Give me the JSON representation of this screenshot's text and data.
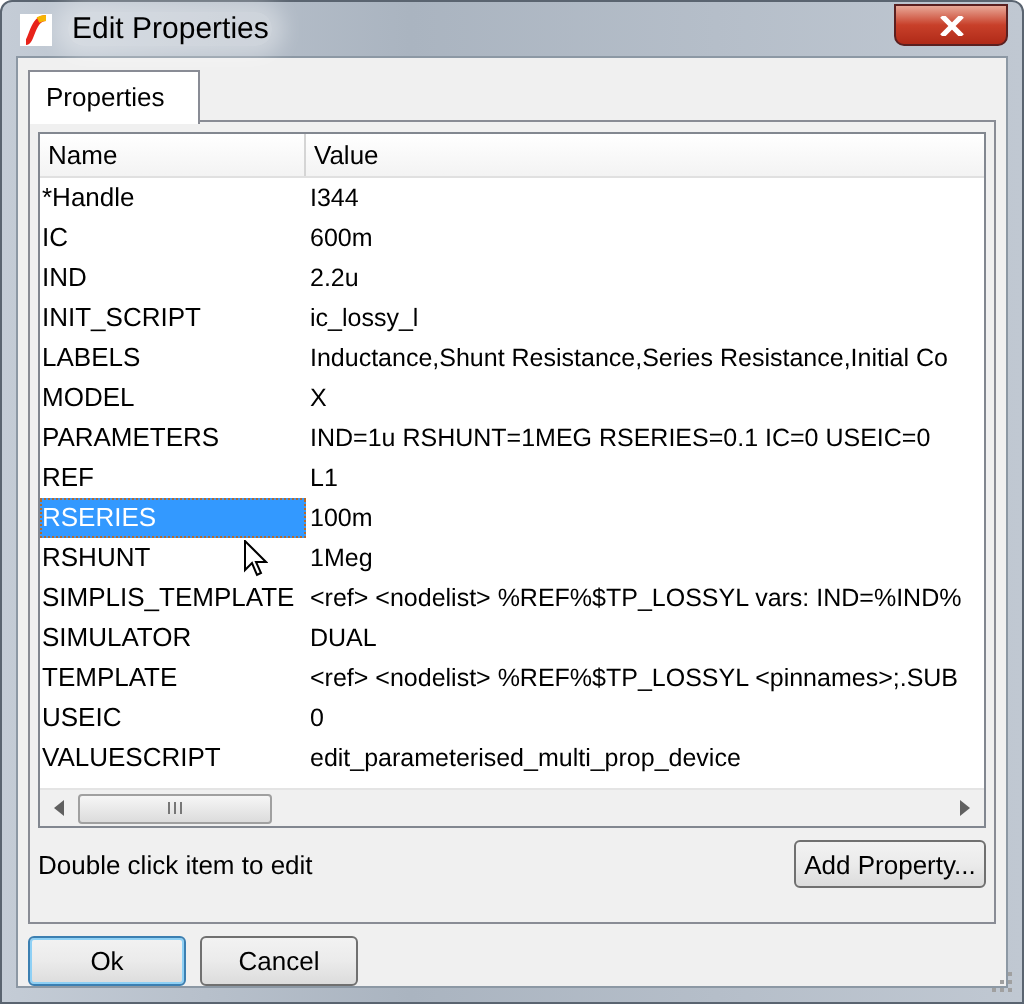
{
  "window": {
    "title": "Edit Properties"
  },
  "tabs": [
    {
      "label": "Properties",
      "selected": true
    }
  ],
  "table": {
    "columns": [
      "Name",
      "Value"
    ],
    "rows": [
      {
        "name": "*Handle",
        "value": "I344",
        "selected": false
      },
      {
        "name": "IC",
        "value": "600m",
        "selected": false
      },
      {
        "name": "IND",
        "value": "2.2u",
        "selected": false
      },
      {
        "name": "INIT_SCRIPT",
        "value": "ic_lossy_l",
        "selected": false
      },
      {
        "name": "LABELS",
        "value": "Inductance,Shunt Resistance,Series Resistance,Initial Co",
        "selected": false
      },
      {
        "name": "MODEL",
        "value": "X",
        "selected": false
      },
      {
        "name": "PARAMETERS",
        "value": "IND=1u RSHUNT=1MEG RSERIES=0.1 IC=0 USEIC=0",
        "selected": false
      },
      {
        "name": "REF",
        "value": "L1",
        "selected": false
      },
      {
        "name": "RSERIES",
        "value": "100m",
        "selected": true
      },
      {
        "name": "RSHUNT",
        "value": "1Meg",
        "selected": false
      },
      {
        "name": "SIMPLIS_TEMPLATE",
        "value": "<ref> <nodelist> %REF%$TP_LOSSYL vars: IND=%IND%",
        "selected": false
      },
      {
        "name": "SIMULATOR",
        "value": "DUAL",
        "selected": false
      },
      {
        "name": "TEMPLATE",
        "value": "<ref> <nodelist> %REF%$TP_LOSSYL <pinnames>;.SUB",
        "selected": false
      },
      {
        "name": "USEIC",
        "value": "0",
        "selected": false
      },
      {
        "name": "VALUESCRIPT",
        "value": "edit_parameterised_multi_prop_device",
        "selected": false
      }
    ]
  },
  "hint": "Double click item to edit",
  "add_button": "Add Property...",
  "buttons": [
    {
      "label": "Ok",
      "default": true
    },
    {
      "label": "Cancel",
      "default": false
    }
  ]
}
